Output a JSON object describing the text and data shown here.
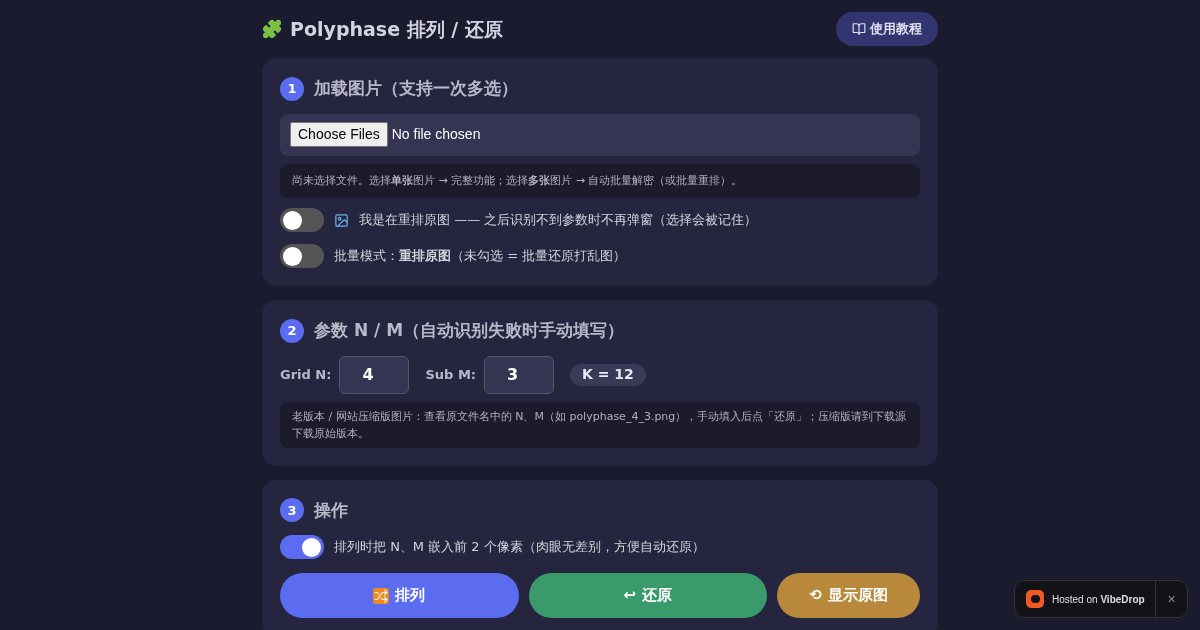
{
  "header": {
    "title": "Polyphase 排列 / 还原",
    "tutorial_button": "使用教程"
  },
  "step1": {
    "number": "1",
    "title": "加载图片（支持一次多选）",
    "file_button": "Choose Files",
    "file_status": "No file chosen",
    "hint": "尚未选择文件。选择**单张**图片 → 完整功能；选择**多张**图片 → 自动批量解密（或批量重排）。",
    "toggles": [
      {
        "label": "我是在重排原图 —— 之后识别不到参数时不再弹窗（选择会被记住）",
        "icon": true,
        "on": false
      },
      {
        "label": "批量模式：**重排原图**（未勾选 = 批量还原打乱图）",
        "icon": false,
        "on": false
      }
    ]
  },
  "step2": {
    "number": "2",
    "title": "参数 N / M（自动识别失败时手动填写）",
    "fields": [
      {
        "label": "Grid N:",
        "value": "4"
      },
      {
        "label": "Sub M:",
        "value": "3"
      }
    ],
    "k_badge": "K = 12",
    "hint": "老版本 / 网站压缩版图片：查看原文件名中的 N、M（如 polyphase_4_3.png），手动填入后点「还原」；压缩版请到下载源下载原始版本。"
  },
  "step3": {
    "number": "3",
    "title": "操作",
    "toggles": [
      {
        "label": "排列时把 N、M 嵌入前 2 个像素（肉眼无差别，方便自动还原）",
        "icon": false,
        "on": true
      }
    ],
    "buttons": [
      {
        "kind": "shuffle",
        "label": "排列"
      },
      {
        "kind": "restore",
        "glyph": "↩",
        "label": "还原"
      },
      {
        "kind": "original",
        "glyph": "⟲",
        "label": "显示原图"
      }
    ]
  },
  "badge": {
    "text": "Hosted on **VibeDrop**",
    "close": "×"
  }
}
